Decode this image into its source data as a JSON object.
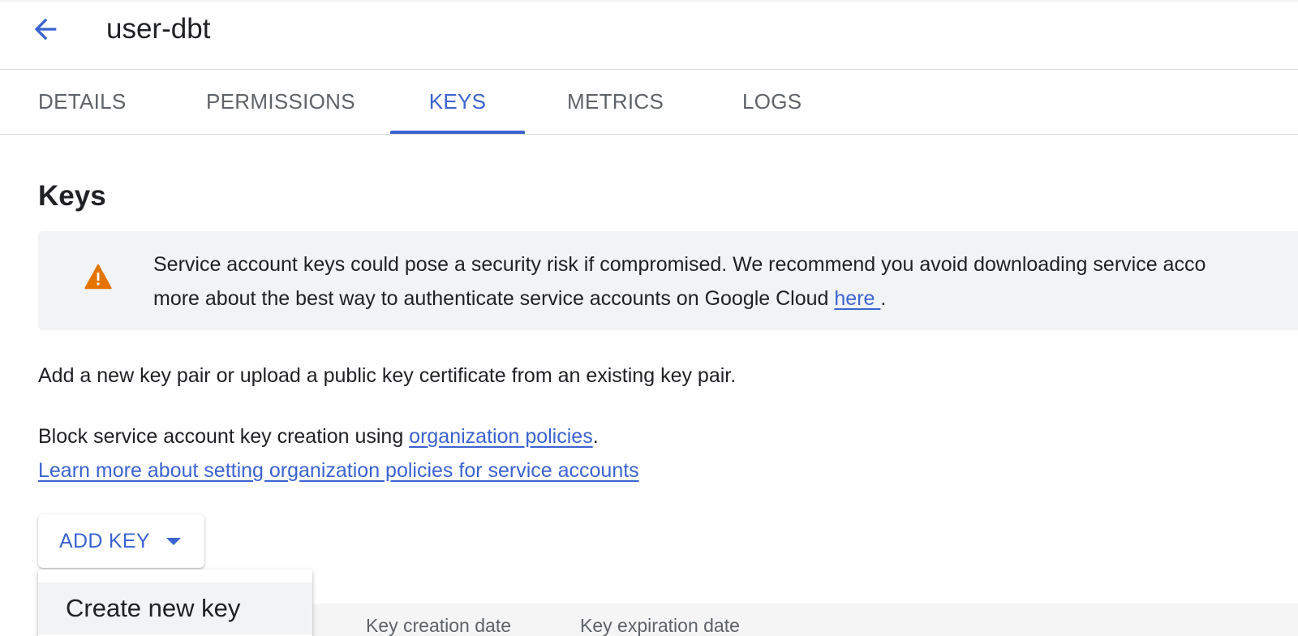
{
  "header": {
    "title": "user-dbt",
    "back_icon": "arrow-left-icon"
  },
  "tabs": [
    {
      "label": "DETAILS",
      "active": false
    },
    {
      "label": "PERMISSIONS",
      "active": false
    },
    {
      "label": "KEYS",
      "active": true
    },
    {
      "label": "METRICS",
      "active": false
    },
    {
      "label": "LOGS",
      "active": false
    }
  ],
  "keys": {
    "title": "Keys",
    "warning": {
      "icon": "warning-icon",
      "line1": "Service account keys could pose a security risk if compromised. We recommend you avoid downloading service acco",
      "line2_prefix": "more about the best way to authenticate service accounts on Google Cloud ",
      "line2_link": "here ",
      "line2_suffix": "."
    },
    "description": "Add a new key pair or upload a public key certificate from an existing key pair.",
    "policy": {
      "prefix": "Block service account key creation using ",
      "link": "organization policies",
      "suffix": "."
    },
    "learn_more_link": "Learn more about setting organization policies for service accounts",
    "add_key_label": "ADD KEY",
    "menu": {
      "items": [
        "Create new key"
      ]
    },
    "table": {
      "columns": [
        "Key creation date",
        "Key expiration date"
      ]
    }
  },
  "colors": {
    "accent": "#3c64d0",
    "warning": "#e37400",
    "text": "#202124",
    "muted": "#5f6368",
    "panel": "#f1f3f4"
  }
}
